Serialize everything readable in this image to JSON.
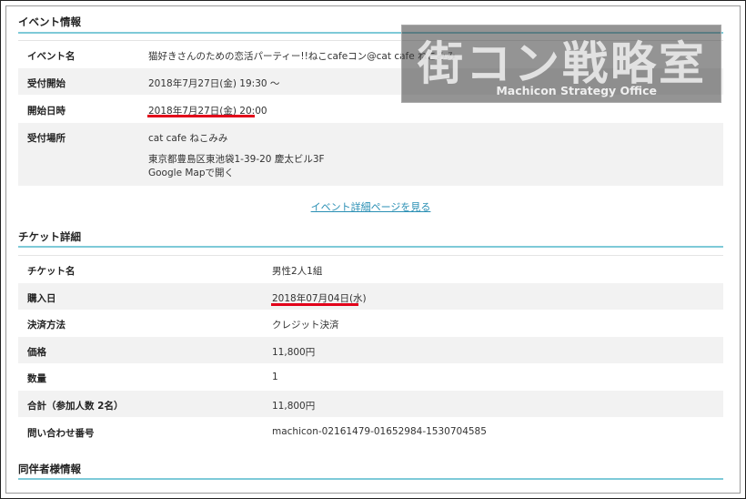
{
  "event_info": {
    "title": "イベント情報",
    "rows": [
      {
        "label": "イベント名",
        "value": "猫好きさんのための恋活パーティー!!ねこcafeコン@cat cafe ねこみみ"
      },
      {
        "label": "受付開始",
        "value": "2018年7月27日(金) 19:30 〜"
      },
      {
        "label": "開始日時",
        "value": "2018年7月27日(金) 20:00"
      },
      {
        "label": "受付場所",
        "value": "cat cafe ねこみみ",
        "address": "東京都豊島区東池袋1-39-20 慶太ビル3F",
        "map_link": "Google Mapで開く"
      }
    ],
    "detail_link": "イベント詳細ページを見る"
  },
  "ticket_info": {
    "title": "チケット詳細",
    "rows": [
      {
        "label": "チケット名",
        "value": "男性2人1組"
      },
      {
        "label": "購入日",
        "value": "2018年07月04日(水)"
      },
      {
        "label": "決済方法",
        "value": "クレジット決済"
      },
      {
        "label": "価格",
        "value": "11,800円"
      },
      {
        "label": "数量",
        "value": "1"
      },
      {
        "label": "合計（参加人数 2名）",
        "value": "11,800円"
      },
      {
        "label": "問い合わせ番号",
        "value": "machicon-02161479-01652984-1530704585"
      }
    ]
  },
  "companion_info": {
    "title": "同伴者様情報"
  },
  "watermark": {
    "main": "街コン戦略室",
    "sub": "Machicon Strategy Office"
  },
  "colors": {
    "accent_rule": "#7ecad8",
    "link": "#2a8fb4",
    "highlight_underline": "#e2001a",
    "row_alt": "#f2f2f2"
  }
}
